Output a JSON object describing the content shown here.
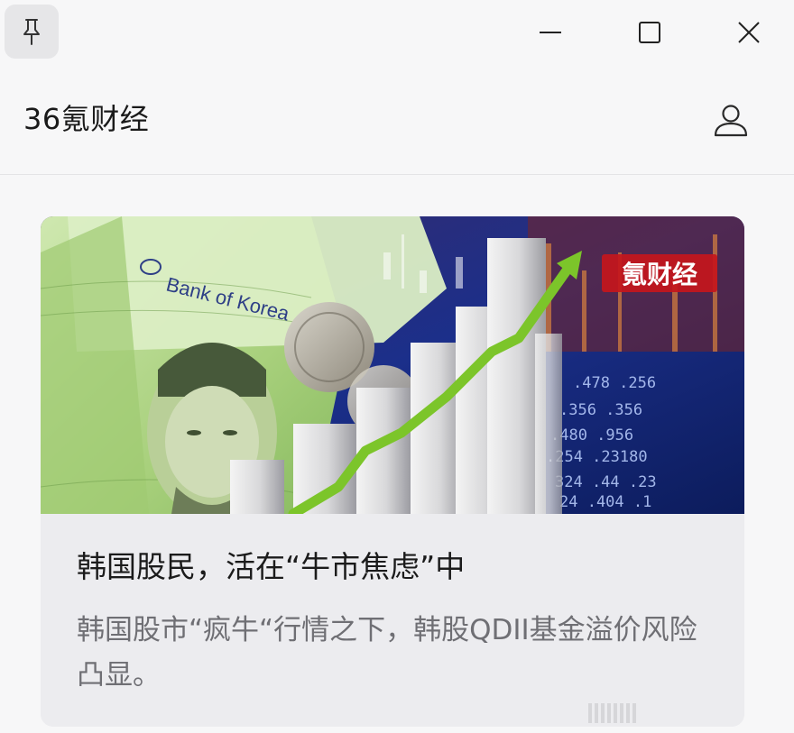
{
  "window": {
    "pin_icon": "pin-icon",
    "minimize_icon": "minimize-icon",
    "maximize_icon": "maximize-icon",
    "close_icon": "close-icon"
  },
  "header": {
    "app_title": "36氪财经",
    "account_icon": "user-icon"
  },
  "card": {
    "image_badge": "氪财经",
    "image_banknote_text": "Bank of Korea",
    "headline": "韩国股民，活在“牛市焦虑”中",
    "summary": "韩国股市“疯牛“行情之下，韩股QDII基金溢价风险凸显。"
  },
  "colors": {
    "background": "#f7f7f8",
    "card_background": "#ececef",
    "headline": "#1b1b1b",
    "summary": "#6f6f74",
    "badge_red": "#c4161c",
    "arrow_green": "#7cc52a"
  }
}
